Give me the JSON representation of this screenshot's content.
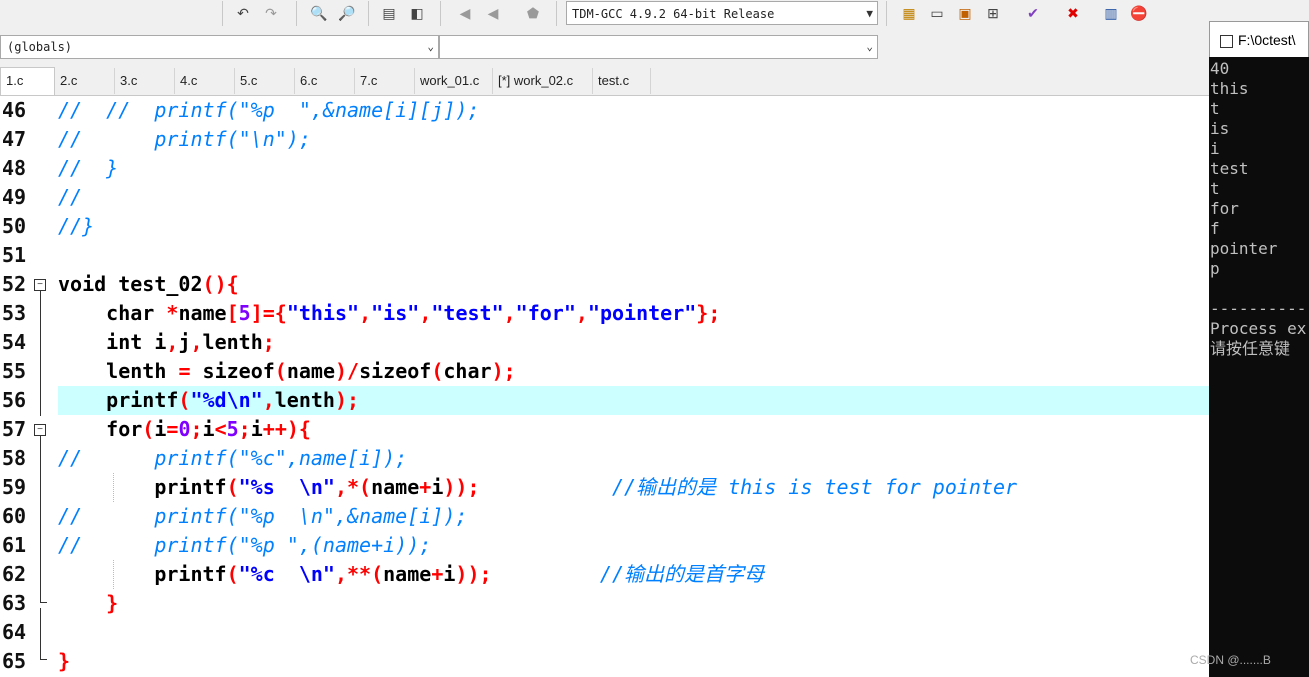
{
  "toolbar": {
    "compiler_select": "TDM-GCC 4.9.2 64-bit Release",
    "icons": [
      "undo-icon",
      "redo-icon",
      "find-icon",
      "find-next-icon",
      "indent-icon",
      "unindent-icon",
      "bookmark-toggle-icon",
      "bookmark-prev-icon",
      "bookmark-clear-icon",
      "new-project-icon",
      "new-window-icon",
      "grid-icon",
      "tiles-icon",
      "check-icon",
      "close-icon",
      "chart-icon",
      "stop-icon"
    ]
  },
  "scope": {
    "globals_combo": "(globals)",
    "member_combo": ""
  },
  "tabs": [
    "1.c",
    "2.c",
    "3.c",
    "4.c",
    "5.c",
    "6.c",
    "7.c",
    "work_01.c",
    "[*] work_02.c",
    "test.c"
  ],
  "line_numbers": [
    "46",
    "47",
    "48",
    "49",
    "50",
    "51",
    "52",
    "53",
    "54",
    "55",
    "56",
    "57",
    "58",
    "59",
    "60",
    "61",
    "62",
    "63",
    "64",
    "65"
  ],
  "code": [
    "//  //  printf(\"%p  \",&name[i][j]);",
    "//      printf(\"\\n\");",
    "//  }",
    "//",
    "//}",
    "",
    "void test_02(){",
    "    char *name[5]={\"this\",\"is\",\"test\",\"for\",\"pointer\"};",
    "    int i,j,lenth;",
    "    lenth = sizeof(name)/sizeof(char);",
    "    printf(\"%d\\n\",lenth);",
    "    for(i=0;i<5;i++){",
    "//      printf(\"%c\",name[i]);",
    "        printf(\"%s  \\n\",*(name+i));           //输出的是 this is test for pointer",
    "//      printf(\"%p  \\n\",&name[i]);",
    "//      printf(\"%p \",(name+i));",
    "        printf(\"%c  \\n\",**(name+i));         //输出的是首字母",
    "    }",
    "",
    "}"
  ],
  "console": {
    "title": "F:\\0ctest\\",
    "lines": [
      "40",
      "this",
      "t",
      "is",
      "i",
      "test",
      "t",
      "for",
      "f",
      "pointer",
      "p",
      "",
      "------------",
      "Process ex",
      "请按任意键"
    ]
  },
  "watermark": "CSDN @.......B",
  "colors": {
    "keyword": "#000000",
    "symbol": "#ff0000",
    "string": "#0000ff",
    "number": "#8000ff",
    "comment": "#0080ff",
    "highlight": "#ccffff",
    "console_bg": "#0c0c0c",
    "console_fg": "#c0c0c0"
  }
}
